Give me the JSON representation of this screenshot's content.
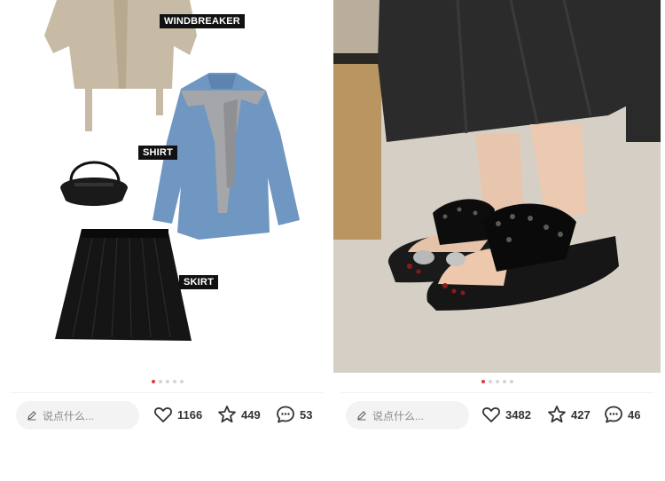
{
  "cards": [
    {
      "tags": [
        "WINDBREAKER",
        "SHIRT",
        "SKIRT"
      ],
      "carousel": {
        "total": 5,
        "active": 0
      },
      "comment_placeholder": "说点什么...",
      "icons": {
        "edit": "pencil-icon",
        "like": "heart-icon",
        "collect": "star-icon",
        "comment": "chat-bubble-icon"
      },
      "likes": "1166",
      "collects": "449",
      "comments": "53"
    },
    {
      "carousel": {
        "total": 5,
        "active": 0
      },
      "comment_placeholder": "说点什么...",
      "icons": {
        "edit": "pencil-icon",
        "like": "heart-icon",
        "collect": "star-icon",
        "comment": "chat-bubble-icon"
      },
      "likes": "3482",
      "collects": "427",
      "comments": "46"
    }
  ],
  "colors": {
    "active_dot": "#e03c3c",
    "input_bg": "#f3f3f3",
    "text": "#333333"
  }
}
